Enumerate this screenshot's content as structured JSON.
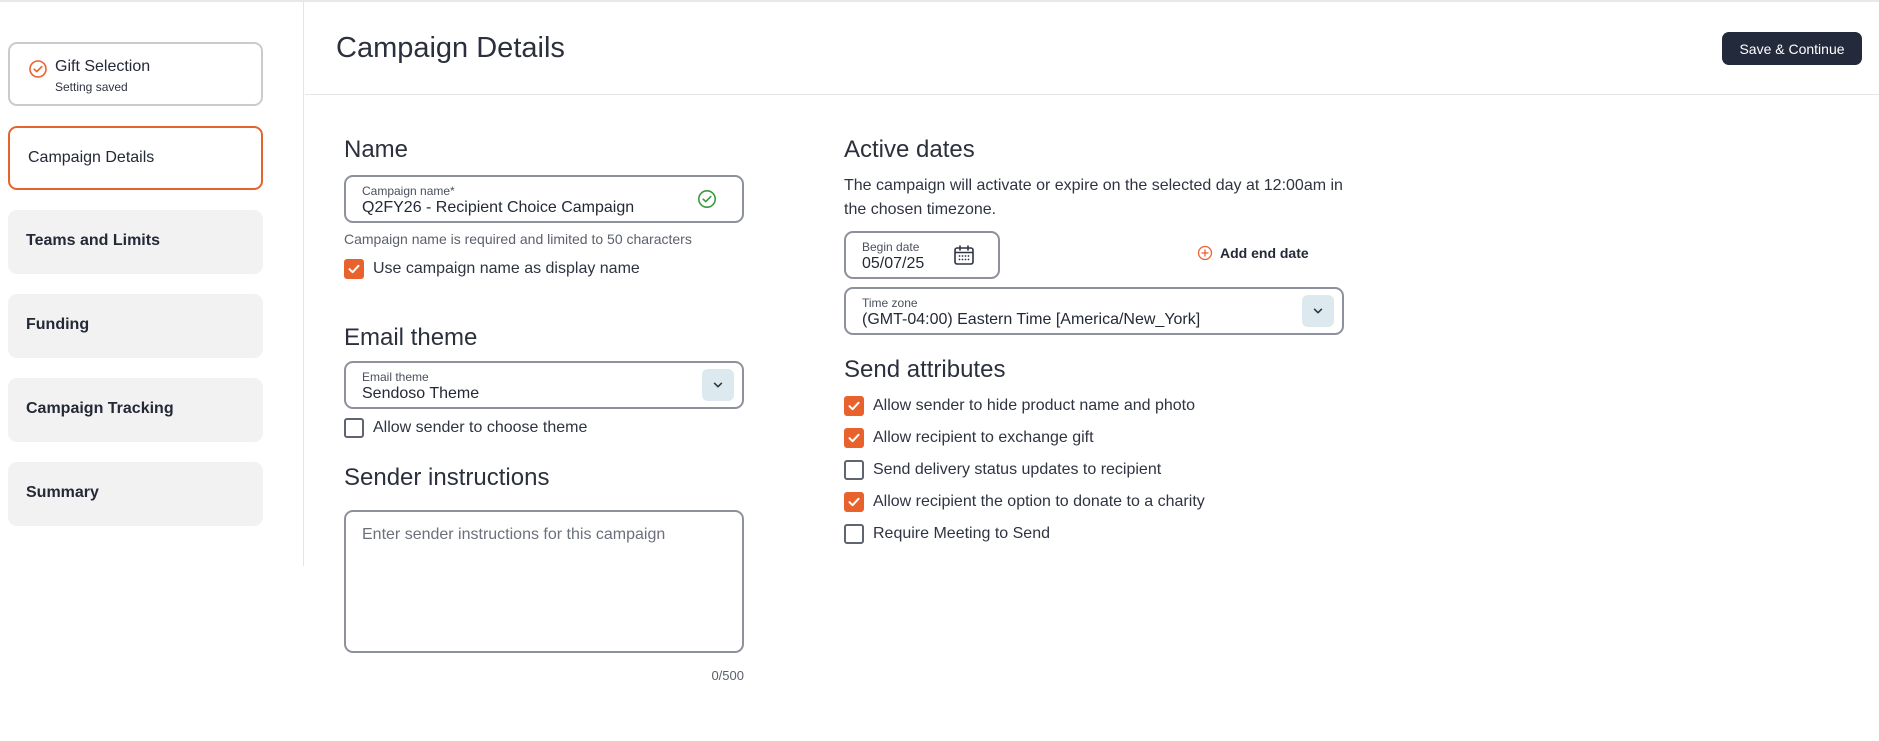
{
  "sidebar": {
    "items": [
      {
        "label": "Gift Selection",
        "sub": "Setting saved",
        "state": "done"
      },
      {
        "label": "Campaign Details",
        "state": "active"
      },
      {
        "label": "Teams and Limits",
        "state": "pending"
      },
      {
        "label": "Funding",
        "state": "pending"
      },
      {
        "label": "Campaign Tracking",
        "state": "pending"
      },
      {
        "label": "Summary",
        "state": "pending"
      }
    ]
  },
  "header": {
    "title": "Campaign Details",
    "save_label": "Save & Continue"
  },
  "name_section": {
    "title": "Name",
    "field_label": "Campaign name*",
    "field_value": "Q2FY26 - Recipient Choice Campaign",
    "helper": "Campaign name is required and limited to 50 characters",
    "display_name_checkbox": {
      "label": "Use campaign name as display name",
      "checked": true
    }
  },
  "email_theme_section": {
    "title": "Email theme",
    "field_label": "Email theme",
    "field_value": "Sendoso Theme",
    "choose_theme_checkbox": {
      "label": "Allow sender to choose theme",
      "checked": false
    }
  },
  "sender_instructions_section": {
    "title": "Sender instructions",
    "placeholder": "Enter sender instructions for this campaign",
    "counter": "0/500"
  },
  "active_dates_section": {
    "title": "Active dates",
    "description": "The campaign will activate or expire on the selected day at 12:00am in the chosen timezone.",
    "begin_date_label": "Begin date",
    "begin_date_value": "05/07/25",
    "add_end_date_label": "Add end date",
    "timezone_label": "Time zone",
    "timezone_value": "(GMT-04:00) Eastern Time [America/New_York]"
  },
  "send_attributes_section": {
    "title": "Send attributes",
    "options": [
      {
        "label": "Allow sender to hide product name and photo",
        "checked": true
      },
      {
        "label": "Allow recipient to exchange gift",
        "checked": true
      },
      {
        "label": "Send delivery status updates to recipient",
        "checked": false
      },
      {
        "label": "Allow recipient the option to donate to a charity",
        "checked": true
      },
      {
        "label": "Require Meeting to Send",
        "checked": false
      }
    ]
  },
  "colors": {
    "accent": "#e8622e",
    "success": "#3a9a3e",
    "primary_button": "#232a3b",
    "dropdown_button": "#dce9ee"
  }
}
